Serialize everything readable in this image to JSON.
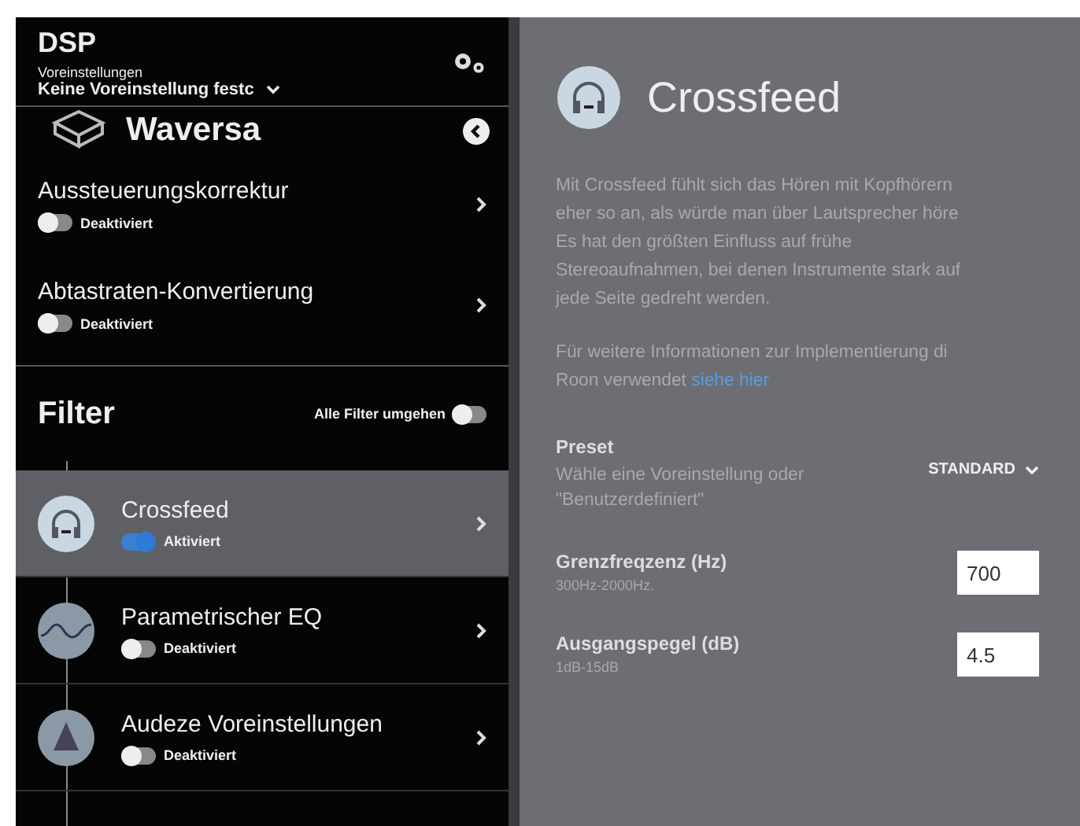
{
  "sidebar": {
    "title": "DSP",
    "preset_label": "Voreinstellungen",
    "preset_value": "Keine Voreinstellung festc",
    "device": "Waversa",
    "settings": [
      {
        "title": "Aussteuerungskorrektur",
        "on": false,
        "status": "Deaktiviert"
      },
      {
        "title": "Abtastraten-Konvertierung",
        "on": false,
        "status": "Deaktiviert"
      }
    ],
    "filter_heading": "Filter",
    "bypass_label": "Alle Filter umgehen",
    "bypass_on": false,
    "filters": [
      {
        "kind": "headphones",
        "title": "Crossfeed",
        "on": true,
        "status": "Aktiviert",
        "selected": true
      },
      {
        "kind": "eq",
        "title": "Parametrischer EQ",
        "on": false,
        "status": "Deaktiviert",
        "selected": false
      },
      {
        "kind": "triangle",
        "title": "Audeze Voreinstellungen",
        "on": false,
        "status": "Deaktiviert",
        "selected": false
      }
    ]
  },
  "detail": {
    "title": "Crossfeed",
    "paragraph_1": [
      "Mit Crossfeed fühlt sich das Hören mit Kopfhörern",
      "eher so an, als würde man über Lautsprecher höre",
      "Es hat den größten Einfluss auf frühe",
      "Stereoaufnahmen, bei denen Instrumente stark auf",
      "jede Seite gedreht werden."
    ],
    "paragraph_2": [
      "Für weitere Informationen zur Implementierung di",
      "Roon verwendet "
    ],
    "link": "siehe hier",
    "preset": {
      "label": "Preset",
      "hint": "Wähle eine Voreinstellung oder \"Benutzerdefiniert\"",
      "value": "STANDARD"
    },
    "fields": [
      {
        "label": "Grenzfreqzenz (Hz)",
        "range": "300Hz-2000Hz.",
        "value": "700"
      },
      {
        "label": "Ausgangspegel (dB)",
        "range": "1dB-15dB",
        "value": "4.5"
      }
    ]
  }
}
